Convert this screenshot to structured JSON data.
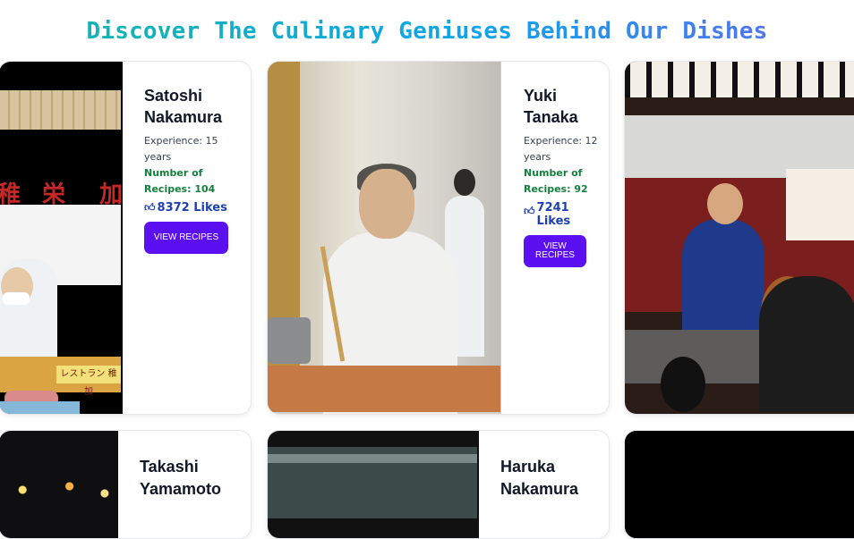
{
  "page": {
    "heading": "Discover The Culinary Geniuses Behind Our Dishes"
  },
  "chefs": [
    {
      "name_line1": "Satoshi",
      "name_line2": "Nakamura",
      "experience": "Experience: 15 years",
      "recipes": "Number of Recipes: 104",
      "likes": "8372 Likes",
      "button": "VIEW RECIPES",
      "photo_text": [
        "稚",
        "栄",
        "加"
      ],
      "sign_text": "レストラン 稚加"
    },
    {
      "name_line1": "Yuki",
      "name_line2": "Tanaka",
      "experience": "Experience: 12 years",
      "recipes": "Number of Recipes: 92",
      "likes": "7241 Likes",
      "button": "VIEW RECIPES"
    },
    {
      "name_line1": "Takashi",
      "name_line2": "Yamamoto"
    },
    {
      "name_line1": "Haruka",
      "name_line2": "Nakamura"
    }
  ],
  "theme": {
    "heading_gradient": [
      "#14b8a6",
      "#0ea5e9",
      "#6366f1"
    ],
    "button_color": "#5b10f2",
    "recipes_color": "#15803d",
    "likes_color": "#1e40af"
  },
  "icons": {
    "likes": "thumbs-up-icon"
  }
}
